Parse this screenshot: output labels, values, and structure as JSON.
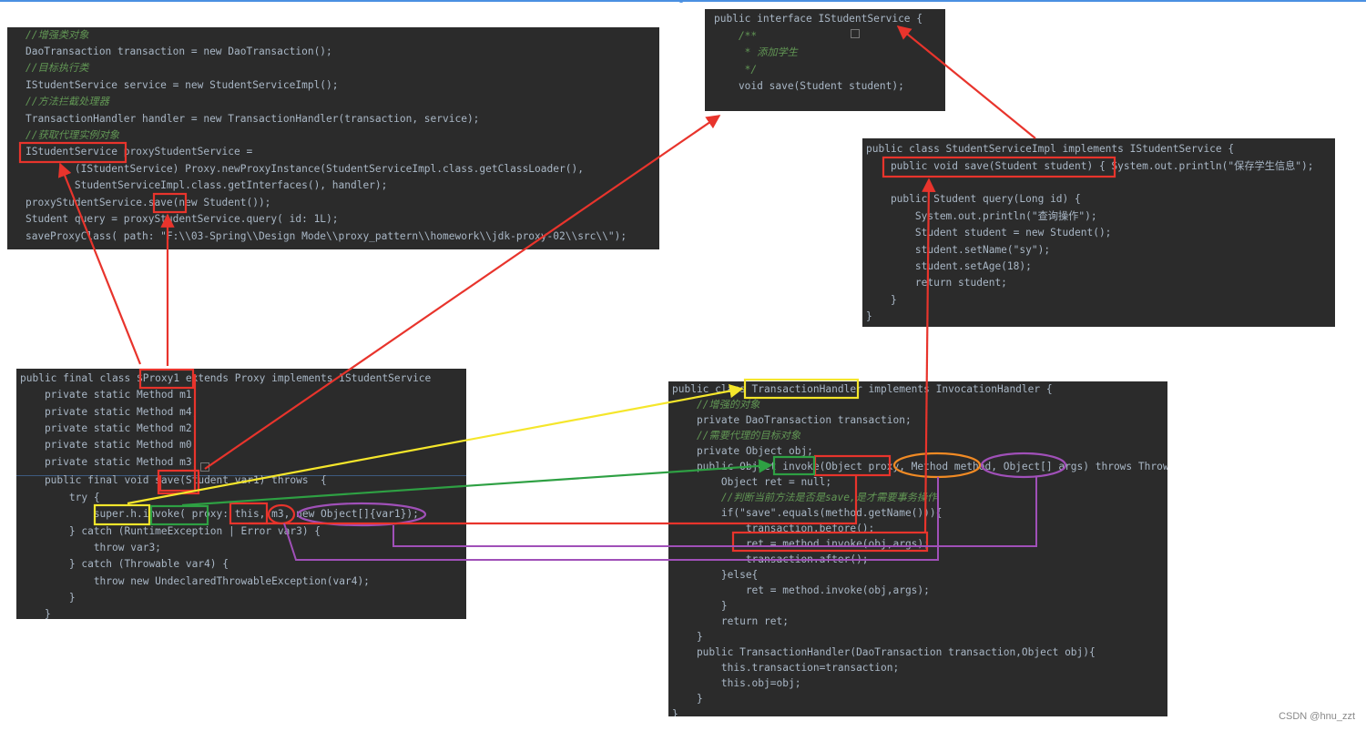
{
  "top_panel": {
    "lines": [
      "//增强类对象",
      "DaoTransaction transaction = new DaoTransaction();",
      "//目标执行类",
      "IStudentService service = new StudentServiceImpl();",
      "//方法拦截处理器",
      "TransactionHandler handler = new TransactionHandler(transaction, service);",
      "//获取代理实例对象",
      "IStudentService proxyStudentService =",
      "        (IStudentService) Proxy.newProxyInstance(StudentServiceImpl.class.getClassLoader(),",
      "        StudentServiceImpl.class.getInterfaces(), handler);",
      "proxyStudentService.save(new Student());",
      "Student query = proxyStudentService.query( id: 1L);",
      "saveProxyClass( path: \"F:\\\\03-Spring\\\\Design Mode\\\\proxy_pattern\\\\homework\\\\jdk-proxy-02\\\\src\\\\\");"
    ]
  },
  "interface_panel": {
    "lines": [
      "public interface IStudentService {",
      "    /**",
      "     * 添加学生",
      "     */",
      "    void save(Student student);"
    ]
  },
  "impl_panel": {
    "lines": [
      "public class StudentServiceImpl implements IStudentService {",
      "    public void save(Student student) { System.out.println(\"保存学生信息\");",
      "",
      "    public Student query(Long id) {",
      "        System.out.println(\"查询操作\");",
      "        Student student = new Student();",
      "        student.setName(\"sy\");",
      "        student.setAge(18);",
      "        return student;",
      "    }",
      "}"
    ]
  },
  "proxy_panel": {
    "lines": [
      "public final class $Proxy1 extends Proxy implements IStudentService",
      "    private static Method m1;",
      "    private static Method m4;",
      "    private static Method m2;",
      "    private static Method m0;",
      "    private static Method m3;",
      "    public final void save(Student var1) throws  {",
      "        try {",
      "            super.h.invoke( proxy: this, m3, new Object[]{var1});",
      "        } catch (RuntimeException | Error var3) {",
      "            throw var3;",
      "        } catch (Throwable var4) {",
      "            throw new UndeclaredThrowableException(var4);",
      "        }",
      "    }"
    ]
  },
  "handler_panel": {
    "lines": [
      "public class TransactionHandler implements InvocationHandler {",
      "    //增强的对象",
      "    private DaoTransaction transaction;",
      "    //需要代理的目标对象",
      "    private Object obj;",
      "    public Object invoke(Object proxy, Method method, Object[] args) throws Throwable",
      "        Object ret = null;",
      "        //判断当前方法是否是save,是才需要事务操作",
      "        if(\"save\".equals(method.getName())){",
      "            transaction.before();",
      "            ret = method.invoke(obj,args);",
      "            transaction.after();",
      "        }else{",
      "            ret = method.invoke(obj,args);",
      "        }",
      "        return ret;",
      "    }",
      "    public TransactionHandler(DaoTransaction transaction,Object obj){",
      "        this.transaction=transaction;",
      "        this.obj=obj;",
      "    }",
      "}"
    ]
  },
  "footer": "CSDN @hnu_zzt",
  "colors": {
    "red": "#e8342c",
    "yellow": "#f5e62b",
    "green": "#2ea043",
    "orange": "#f08a24",
    "purple": "#a050b8"
  }
}
